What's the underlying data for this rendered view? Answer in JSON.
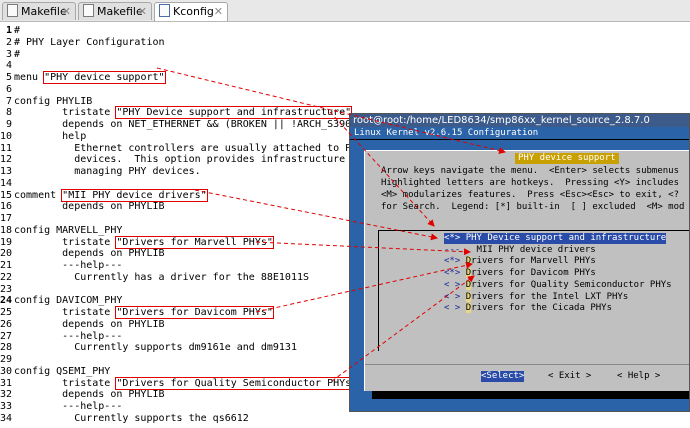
{
  "tabs": [
    {
      "label": "Makefile",
      "close": "✕",
      "icon": "document-icon"
    },
    {
      "label": "Makefile",
      "close": "✕",
      "icon": "document-icon"
    },
    {
      "label": "Kconfig",
      "close": "✕",
      "icon": "document-icon"
    }
  ],
  "editor_lines": [
    {
      "num": "1",
      "pre": "#",
      "hl": "",
      "post": ""
    },
    {
      "num": "2",
      "pre": "# PHY Layer Configuration",
      "hl": "",
      "post": ""
    },
    {
      "num": "3",
      "pre": "#",
      "hl": "",
      "post": ""
    },
    {
      "num": "4",
      "pre": "",
      "hl": "",
      "post": ""
    },
    {
      "num": "5",
      "pre": "menu ",
      "hl": "\"PHY device support\"",
      "post": ""
    },
    {
      "num": "6",
      "pre": "",
      "hl": "",
      "post": ""
    },
    {
      "num": "7",
      "pre": "config PHYLIB",
      "hl": "",
      "post": ""
    },
    {
      "num": "8",
      "pre": "        tristate ",
      "hl": "\"PHY Device support and infrastructure\"",
      "post": ""
    },
    {
      "num": "9",
      "pre": "        depends on NET_ETHERNET && (BROKEN || !ARCH_S390)",
      "hl": "",
      "post": ""
    },
    {
      "num": "10",
      "pre": "        help",
      "hl": "",
      "post": ""
    },
    {
      "num": "11",
      "pre": "          Ethernet controllers are usually attached to PHY",
      "hl": "",
      "post": ""
    },
    {
      "num": "12",
      "pre": "          devices.  This option provides infrastructure for",
      "hl": "",
      "post": ""
    },
    {
      "num": "13",
      "pre": "          managing PHY devices.",
      "hl": "",
      "post": ""
    },
    {
      "num": "14",
      "pre": "",
      "hl": "",
      "post": ""
    },
    {
      "num": "15",
      "pre": "comment ",
      "hl": "\"MII PHY device drivers\"",
      "post": ""
    },
    {
      "num": "16",
      "pre": "        depends on PHYLIB",
      "hl": "",
      "post": ""
    },
    {
      "num": "17",
      "pre": "",
      "hl": "",
      "post": ""
    },
    {
      "num": "18",
      "pre": "config MARVELL_PHY",
      "hl": "",
      "post": ""
    },
    {
      "num": "19",
      "pre": "        tristate ",
      "hl": "\"Drivers for Marvell PHYs\"",
      "post": ""
    },
    {
      "num": "20",
      "pre": "        depends on PHYLIB",
      "hl": "",
      "post": ""
    },
    {
      "num": "21",
      "pre": "        ---help---",
      "hl": "",
      "post": ""
    },
    {
      "num": "22",
      "pre": "          Currently has a driver for the 88E1011S",
      "hl": "",
      "post": ""
    },
    {
      "num": "23",
      "pre": "",
      "hl": "",
      "post": ""
    },
    {
      "num": "24",
      "pre": "config DAVICOM_PHY",
      "hl": "",
      "post": ""
    },
    {
      "num": "25",
      "pre": "        tristate ",
      "hl": "\"Drivers for Davicom PHYs\"",
      "post": ""
    },
    {
      "num": "26",
      "pre": "        depends on PHYLIB",
      "hl": "",
      "post": ""
    },
    {
      "num": "27",
      "pre": "        ---help---",
      "hl": "",
      "post": ""
    },
    {
      "num": "28",
      "pre": "          Currently supports dm9161e and dm9131",
      "hl": "",
      "post": ""
    },
    {
      "num": "29",
      "pre": "",
      "hl": "",
      "post": ""
    },
    {
      "num": "30",
      "pre": "config QSEMI_PHY",
      "hl": "",
      "post": ""
    },
    {
      "num": "31",
      "pre": "        tristate ",
      "hl": "\"Drivers for Quality Semiconductor PHYs\"",
      "post": ""
    },
    {
      "num": "32",
      "pre": "        depends on PHYLIB",
      "hl": "",
      "post": ""
    },
    {
      "num": "33",
      "pre": "        ---help---",
      "hl": "",
      "post": ""
    },
    {
      "num": "34",
      "pre": "          Currently supports the qs6612",
      "hl": "",
      "post": ""
    }
  ],
  "terminal": {
    "title": "root@root:/home/LED8634/smp86xx_kernel_source_2.8.7.0",
    "kernel_line": "Linux Kernel v2.6.15 Configuration",
    "menu_title": "PHY device support",
    "help_lines": [
      "Arrow keys navigate the menu.  <Enter> selects submenus",
      "Highlighted letters are hotkeys.  Pressing <Y> includes",
      "<M> modularizes features.  Press <Esc><Esc> to exit, <?",
      "for Search.  Legend: [*] built-in  [ ] excluded  <M> mod"
    ],
    "menu_items": [
      {
        "prefix": "<*>",
        "hotkey": "P",
        "rest": "HY Device support and infrastructure",
        "selected": true
      },
      {
        "prefix": "---",
        "hotkey": "",
        "rest": "  MII PHY device drivers",
        "selected": false
      },
      {
        "prefix": "<*>",
        "hotkey": "D",
        "rest": "rivers for Marvell PHYs",
        "selected": false
      },
      {
        "prefix": "<*>",
        "hotkey": "D",
        "rest": "rivers for Davicom PHYs",
        "selected": false
      },
      {
        "prefix": "< >",
        "hotkey": "D",
        "rest": "rivers for Quality Semiconductor PHYs",
        "selected": false
      },
      {
        "prefix": "< >",
        "hotkey": "D",
        "rest": "rivers for the Intel LXT PHYs",
        "selected": false
      },
      {
        "prefix": "< >",
        "hotkey": "D",
        "rest": "rivers for the Cicada PHYs",
        "selected": false
      }
    ],
    "buttons": [
      {
        "label": "<Select>",
        "selected": true
      },
      {
        "label": "< Exit >",
        "selected": false
      },
      {
        "label": "< Help >",
        "selected": false
      }
    ]
  },
  "colors": {
    "annotation": "#e00000",
    "terminal_bg": "#2a63a8",
    "dialog_bg": "#c0c0c0",
    "menu_title_bg": "#c8a000",
    "selection": "#2a4ca8"
  }
}
